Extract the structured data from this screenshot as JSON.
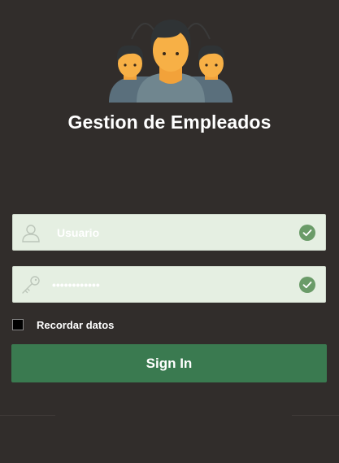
{
  "app": {
    "title": "Gestion de Empleados",
    "logo_icon": "employees-group-icon"
  },
  "form": {
    "username": {
      "placeholder": "Usuario",
      "value": "",
      "lead_icon": "user-icon",
      "status_icon": "check-circle-icon"
    },
    "password": {
      "value": "••••••••••••",
      "lead_icon": "key-icon",
      "status_icon": "check-circle-icon"
    },
    "remember": {
      "label": "Recordar datos",
      "checked": false
    },
    "submit_label": "Sign In"
  },
  "colors": {
    "background": "#312d2b",
    "field_background": "#e5efe2",
    "accent": "#3a7a50",
    "check": "#6a9b68"
  }
}
